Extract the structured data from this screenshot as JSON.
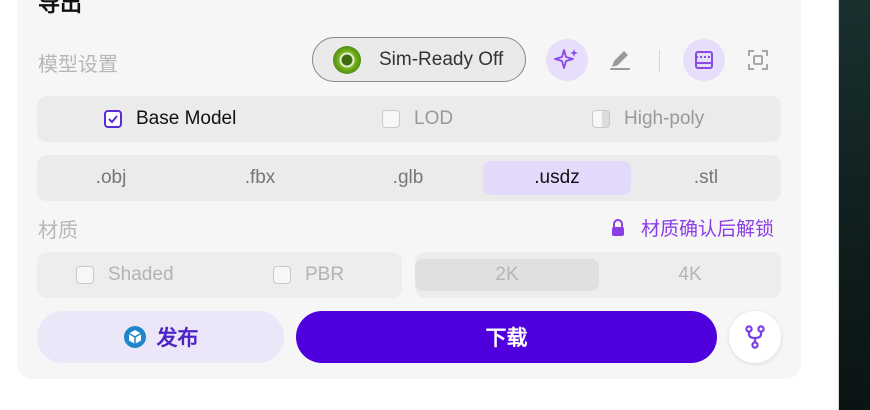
{
  "card": {
    "title": "导出"
  },
  "model_settings": {
    "label": "模型设置",
    "sim_ready": {
      "label": "Sim-Ready Off",
      "enabled": false
    },
    "toolbar_icons": [
      "sparkle-icon",
      "pencil-icon",
      "frame-icon",
      "focus-icon"
    ],
    "options": [
      {
        "label": "Base Model",
        "checked": true
      },
      {
        "label": "LOD",
        "checked": false
      },
      {
        "label": "High-poly",
        "checked": false
      }
    ]
  },
  "formats": {
    "items": [
      ".obj",
      ".fbx",
      ".glb",
      ".usdz",
      ".stl"
    ],
    "selected": ".usdz"
  },
  "material": {
    "label": "材质",
    "lock_note": "材质确认后解锁",
    "options": [
      {
        "label": "Shaded",
        "checked": false
      },
      {
        "label": "PBR",
        "checked": false
      }
    ],
    "resolutions": [
      "2K",
      "4K"
    ],
    "selected_resolution": "2K"
  },
  "actions": {
    "publish_label": "发布",
    "download_label": "下载"
  },
  "colors": {
    "accent": "#5000dd",
    "accent_soft": "#e3d9fb",
    "lock": "#8b3ee6"
  }
}
